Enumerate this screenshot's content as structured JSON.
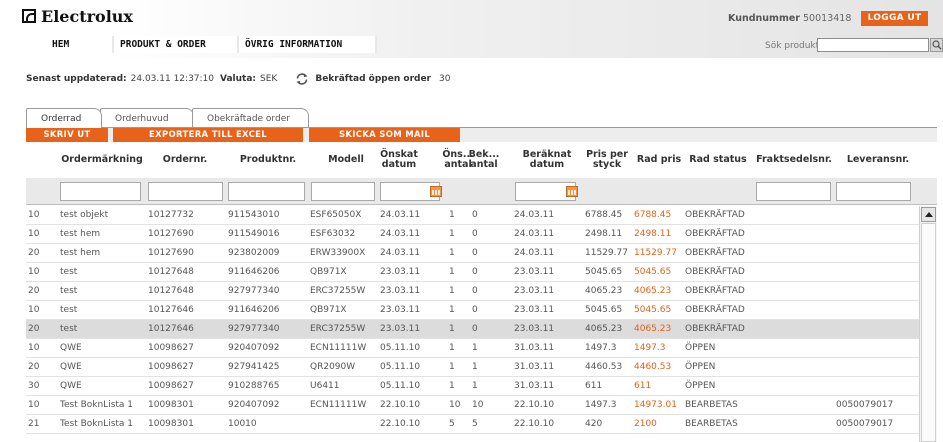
{
  "brand": {
    "name": "Electrolux"
  },
  "nav": {
    "home": "HEM",
    "products": "PRODUKT & ORDER",
    "other": "ÖVRIG INFORMATION"
  },
  "account": {
    "label": "Kundnummer",
    "number": "50013418",
    "logout": "LOGGA UT"
  },
  "search": {
    "label": "Sök produkt",
    "value": ""
  },
  "status": {
    "updated_label": "Senast uppdaterad:",
    "updated_value": "24.03.11 12:37:10",
    "currency_label": "Valuta:",
    "currency_value": "SEK",
    "open_label": "Bekräftad öppen order",
    "open_value": "30"
  },
  "tabs": [
    "Orderrad",
    "Orderhuvud",
    "Obekräftade order"
  ],
  "actions": {
    "print": "SKRIV UT",
    "excel": "EXPORTERA TILL EXCEL",
    "mail": "SKICKA SOM MAIL"
  },
  "columns": [
    {
      "key": "line",
      "label": ""
    },
    {
      "key": "mark",
      "label": "Ordermärkning"
    },
    {
      "key": "order",
      "label": "Ordernr."
    },
    {
      "key": "product",
      "label": "Produktnr."
    },
    {
      "key": "model",
      "label": "Modell"
    },
    {
      "key": "wish_date",
      "label": "Önskat datum"
    },
    {
      "key": "wish_qty",
      "label": "Öns... antal"
    },
    {
      "key": "conf_qty",
      "label": "Bek... antal"
    },
    {
      "key": "calc_date",
      "label": "Beräknat datum"
    },
    {
      "key": "unit_price",
      "label": "Pris per styck"
    },
    {
      "key": "row_price",
      "label": "Rad pris"
    },
    {
      "key": "row_status",
      "label": "Rad status"
    },
    {
      "key": "freight",
      "label": "Fraktsedelsnr."
    },
    {
      "key": "delivery",
      "label": "Leveransnr."
    }
  ],
  "rows": [
    [
      "10",
      "test objekt",
      "10127732",
      "911543010",
      "ESF65050X",
      "24.03.11",
      "1",
      "0",
      "24.03.11",
      "6788.45",
      "6788.45",
      "OBEKRÄFTAD",
      "",
      ""
    ],
    [
      "10",
      "test hem",
      "10127690",
      "911549016",
      "ESF63032",
      "24.03.11",
      "1",
      "0",
      "24.03.11",
      "2498.11",
      "2498.11",
      "OBEKRÄFTAD",
      "",
      ""
    ],
    [
      "20",
      "test hem",
      "10127690",
      "923802009",
      "ERW33900X",
      "24.03.11",
      "1",
      "0",
      "24.03.11",
      "11529.77",
      "11529.77",
      "OBEKRÄFTAD",
      "",
      ""
    ],
    [
      "10",
      "test",
      "10127648",
      "911646206",
      "QB971X",
      "23.03.11",
      "1",
      "0",
      "23.03.11",
      "5045.65",
      "5045.65",
      "OBEKRÄFTAD",
      "",
      ""
    ],
    [
      "20",
      "test",
      "10127648",
      "927977340",
      "ERC37255W",
      "23.03.11",
      "1",
      "0",
      "23.03.11",
      "4065.23",
      "4065.23",
      "OBEKRÄFTAD",
      "",
      ""
    ],
    [
      "10",
      "test",
      "10127646",
      "911646206",
      "QB971X",
      "23.03.11",
      "1",
      "0",
      "23.03.11",
      "5045.65",
      "5045.65",
      "OBEKRÄFTAD",
      "",
      ""
    ],
    [
      "20",
      "test",
      "10127646",
      "927977340",
      "ERC37255W",
      "23.03.11",
      "1",
      "0",
      "23.03.11",
      "4065.23",
      "4065.23",
      "OBEKRÄFTAD",
      "",
      ""
    ],
    [
      "10",
      "QWE",
      "10098627",
      "920407092",
      "ECN11111W",
      "05.11.10",
      "1",
      "1",
      "31.03.11",
      "1497.3",
      "1497.3",
      "ÖPPEN",
      "",
      ""
    ],
    [
      "20",
      "QWE",
      "10098627",
      "927941425",
      "QR2090W",
      "05.11.10",
      "1",
      "1",
      "31.03.11",
      "4460.53",
      "4460.53",
      "ÖPPEN",
      "",
      ""
    ],
    [
      "30",
      "QWE",
      "10098627",
      "910288765",
      "U6411",
      "05.11.10",
      "1",
      "1",
      "31.03.11",
      "611",
      "611",
      "ÖPPEN",
      "",
      ""
    ],
    [
      "10",
      "Test BoknLista 1",
      "10098301",
      "920407092",
      "ECN11111W",
      "22.10.10",
      "10",
      "10",
      "22.10.10",
      "1497.3",
      "14973.01",
      "BEARBETAS",
      "",
      "0050079017"
    ],
    [
      "21",
      "Test BoknLista 1",
      "10098301",
      "10010",
      "",
      "22.10.10",
      "5",
      "5",
      "22.10.10",
      "420",
      "2100",
      "BEARBETAS",
      "",
      "0050079017"
    ]
  ],
  "selected_row": 6,
  "colors": {
    "accent": "#e8621a",
    "price": "#e1621a",
    "selected": "#dcdcdc"
  }
}
